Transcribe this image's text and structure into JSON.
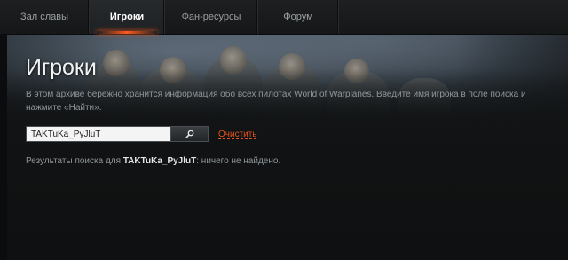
{
  "nav": {
    "tabs": [
      {
        "label": "Зал славы",
        "active": false
      },
      {
        "label": "Игроки",
        "active": true
      },
      {
        "label": "Фан-ресурсы",
        "active": false
      },
      {
        "label": "Форум",
        "active": false
      }
    ]
  },
  "page": {
    "title": "Игроки",
    "description": "В этом архиве бережно хранится информация обо всех пилотах World of Warplanes. Введите имя игрока в поле поиска и нажмите «Найти»."
  },
  "search": {
    "value": "TAKTuKa_PyJluT",
    "button_icon": "search-icon",
    "clear_label": "Очистить"
  },
  "result": {
    "prefix": "Результаты поиска для ",
    "query": "TAKTuKa_PyJluT",
    "suffix": ": ничего не найдено."
  },
  "colors": {
    "accent": "#e0521e",
    "active_tab_underline": "#ff5a1e",
    "background": "#111314"
  }
}
